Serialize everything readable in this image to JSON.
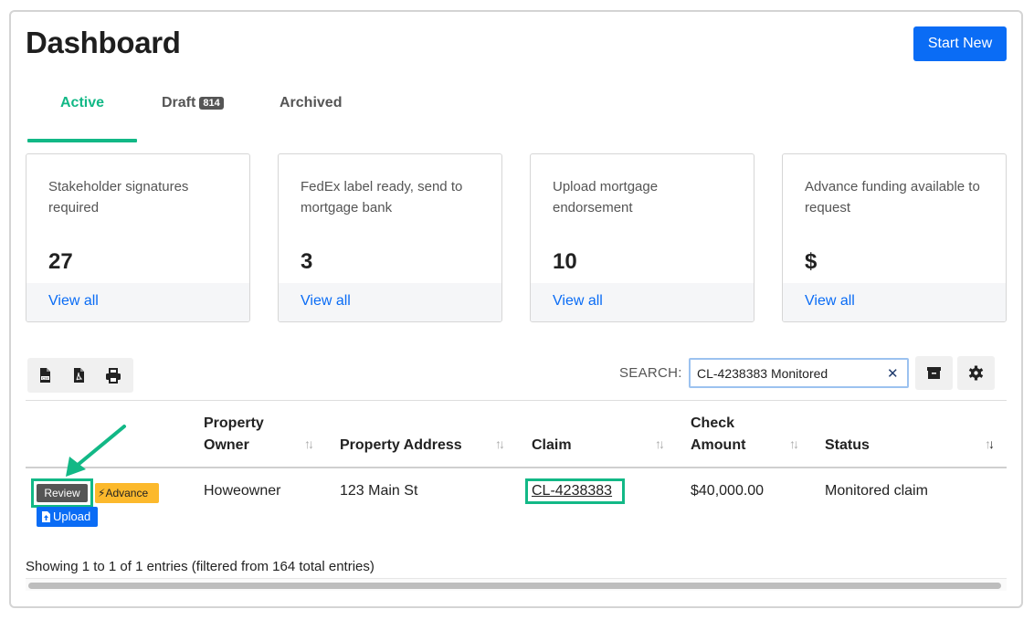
{
  "header": {
    "title": "Dashboard",
    "start_new_label": "Start New"
  },
  "tabs": [
    {
      "label": "Active",
      "active": true
    },
    {
      "label": "Draft",
      "badge": "814"
    },
    {
      "label": "Archived"
    }
  ],
  "cards": [
    {
      "title": "Stakeholder signatures required",
      "value": "27",
      "link": "View all"
    },
    {
      "title": "FedEx label ready, send to mortgage bank",
      "value": "3",
      "link": "View all"
    },
    {
      "title": "Upload mortgage endorsement",
      "value": "10",
      "link": "View all"
    },
    {
      "title": "Advance funding available to request",
      "value": "$",
      "link": "View all"
    }
  ],
  "toolbar": {
    "export_icons": [
      "csv-icon",
      "pdf-icon",
      "print-icon"
    ],
    "search_label": "SEARCH:",
    "search_value": "CL-4238383 Monitored",
    "archive_icon": "archive-icon",
    "settings_icon": "gear-icon"
  },
  "table": {
    "columns": [
      "Property Owner",
      "Property Address",
      "Claim",
      "Check Amount",
      "Status"
    ],
    "rows": [
      {
        "actions": {
          "review": "Review",
          "advance": "Advance",
          "upload": "Upload"
        },
        "owner": "Howeowner",
        "address": "123 Main St",
        "claim": "CL-4238383",
        "amount": "$40,000.00",
        "status": "Monitored claim"
      }
    ],
    "info": "Showing 1 to 1 of 1 entries (filtered from 164 total entries)"
  },
  "colors": {
    "accent": "#12b886",
    "primary": "#0a6cf5",
    "warning": "#fcb92c",
    "dark": "#555555"
  }
}
